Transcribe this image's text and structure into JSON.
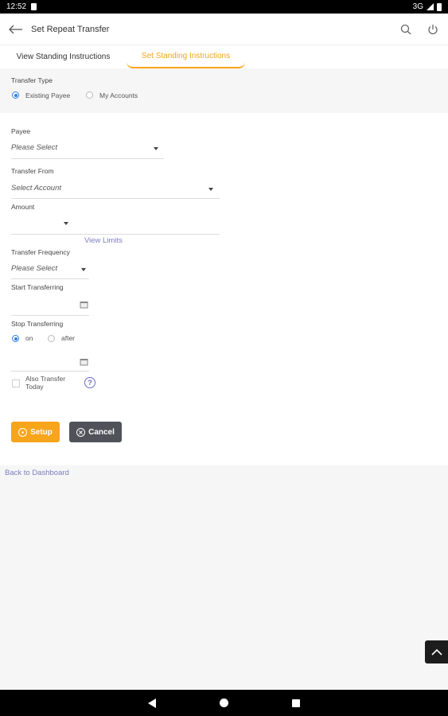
{
  "status_bar": {
    "time": "12:52",
    "network": "3G"
  },
  "app_bar": {
    "title": "Set Repeat Transfer"
  },
  "tabs": [
    {
      "label": "View Standing Instructions",
      "active": false
    },
    {
      "label": "Set Standing Instructions",
      "active": true
    }
  ],
  "transfer_type": {
    "label": "Transfer Type",
    "options": [
      {
        "label": "Existing Payee",
        "selected": true
      },
      {
        "label": "My Accounts",
        "selected": false
      }
    ]
  },
  "payee": {
    "label": "Payee",
    "placeholder": "Please Select"
  },
  "transfer_from": {
    "label": "Transfer From",
    "placeholder": "Select Account"
  },
  "amount": {
    "label": "Amount",
    "value": "",
    "link": "View Limits"
  },
  "frequency": {
    "label": "Transfer Frequency",
    "placeholder": "Please Select"
  },
  "start": {
    "label": "Start Transferring",
    "value": ""
  },
  "stop": {
    "label": "Stop Transferring",
    "options": [
      {
        "label": "on",
        "selected": true
      },
      {
        "label": "after",
        "selected": false
      }
    ],
    "value": ""
  },
  "also_transfer": {
    "label_line1": "Also Transfer",
    "label_line2": "Today",
    "checked": false,
    "help": "?"
  },
  "buttons": {
    "setup": "Setup",
    "cancel": "Cancel"
  },
  "footer": {
    "back_link": "Back to Dashboard"
  },
  "colors": {
    "accent": "#f7a51b",
    "radio": "#2d7fe6",
    "link": "#7b7fc0",
    "cancel": "#4f5258"
  }
}
